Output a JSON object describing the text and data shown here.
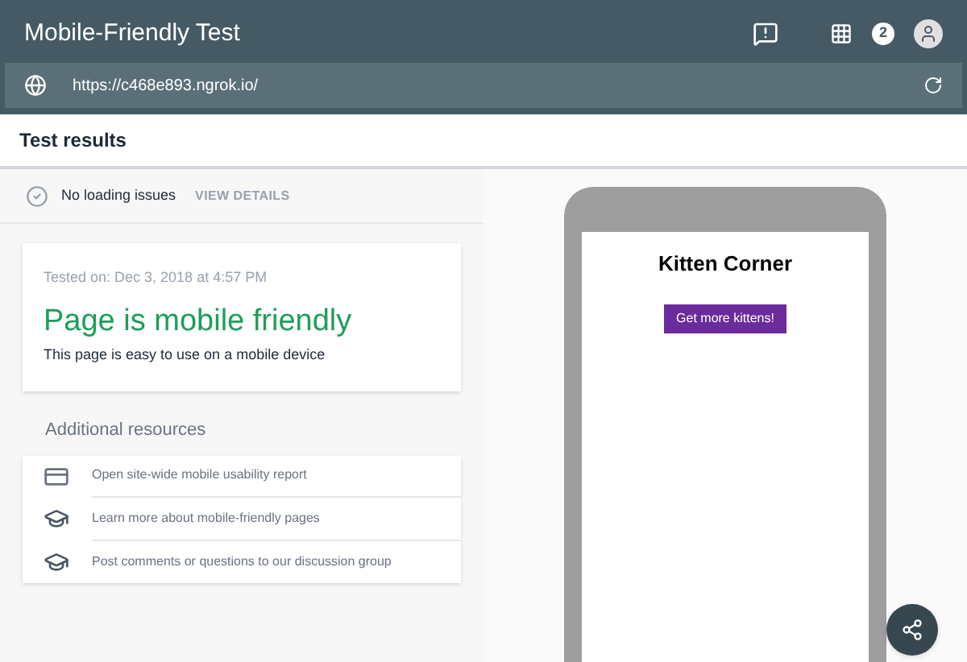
{
  "app_bar": {
    "title": "Mobile-Friendly Test",
    "notification_count": "2"
  },
  "url_bar": {
    "value": "https://c468e893.ngrok.io/"
  },
  "results_header": {
    "title": "Test results"
  },
  "loading_status": {
    "text": "No loading issues",
    "link": "VIEW DETAILS"
  },
  "result_card": {
    "tested_on": "Tested on: Dec 3, 2018 at 4:57 PM",
    "verdict": "Page is mobile friendly",
    "description": "This page is easy to use on a mobile device"
  },
  "resources": {
    "title": "Additional resources",
    "items": [
      {
        "kind": "report",
        "label": "Open site-wide mobile usability report"
      },
      {
        "kind": "school",
        "label": "Learn more about mobile-friendly pages"
      },
      {
        "kind": "school",
        "label": "Post comments or questions to our discussion group"
      }
    ]
  },
  "phone_preview": {
    "heading": "Kitten Corner",
    "button": "Get more kittens!"
  }
}
